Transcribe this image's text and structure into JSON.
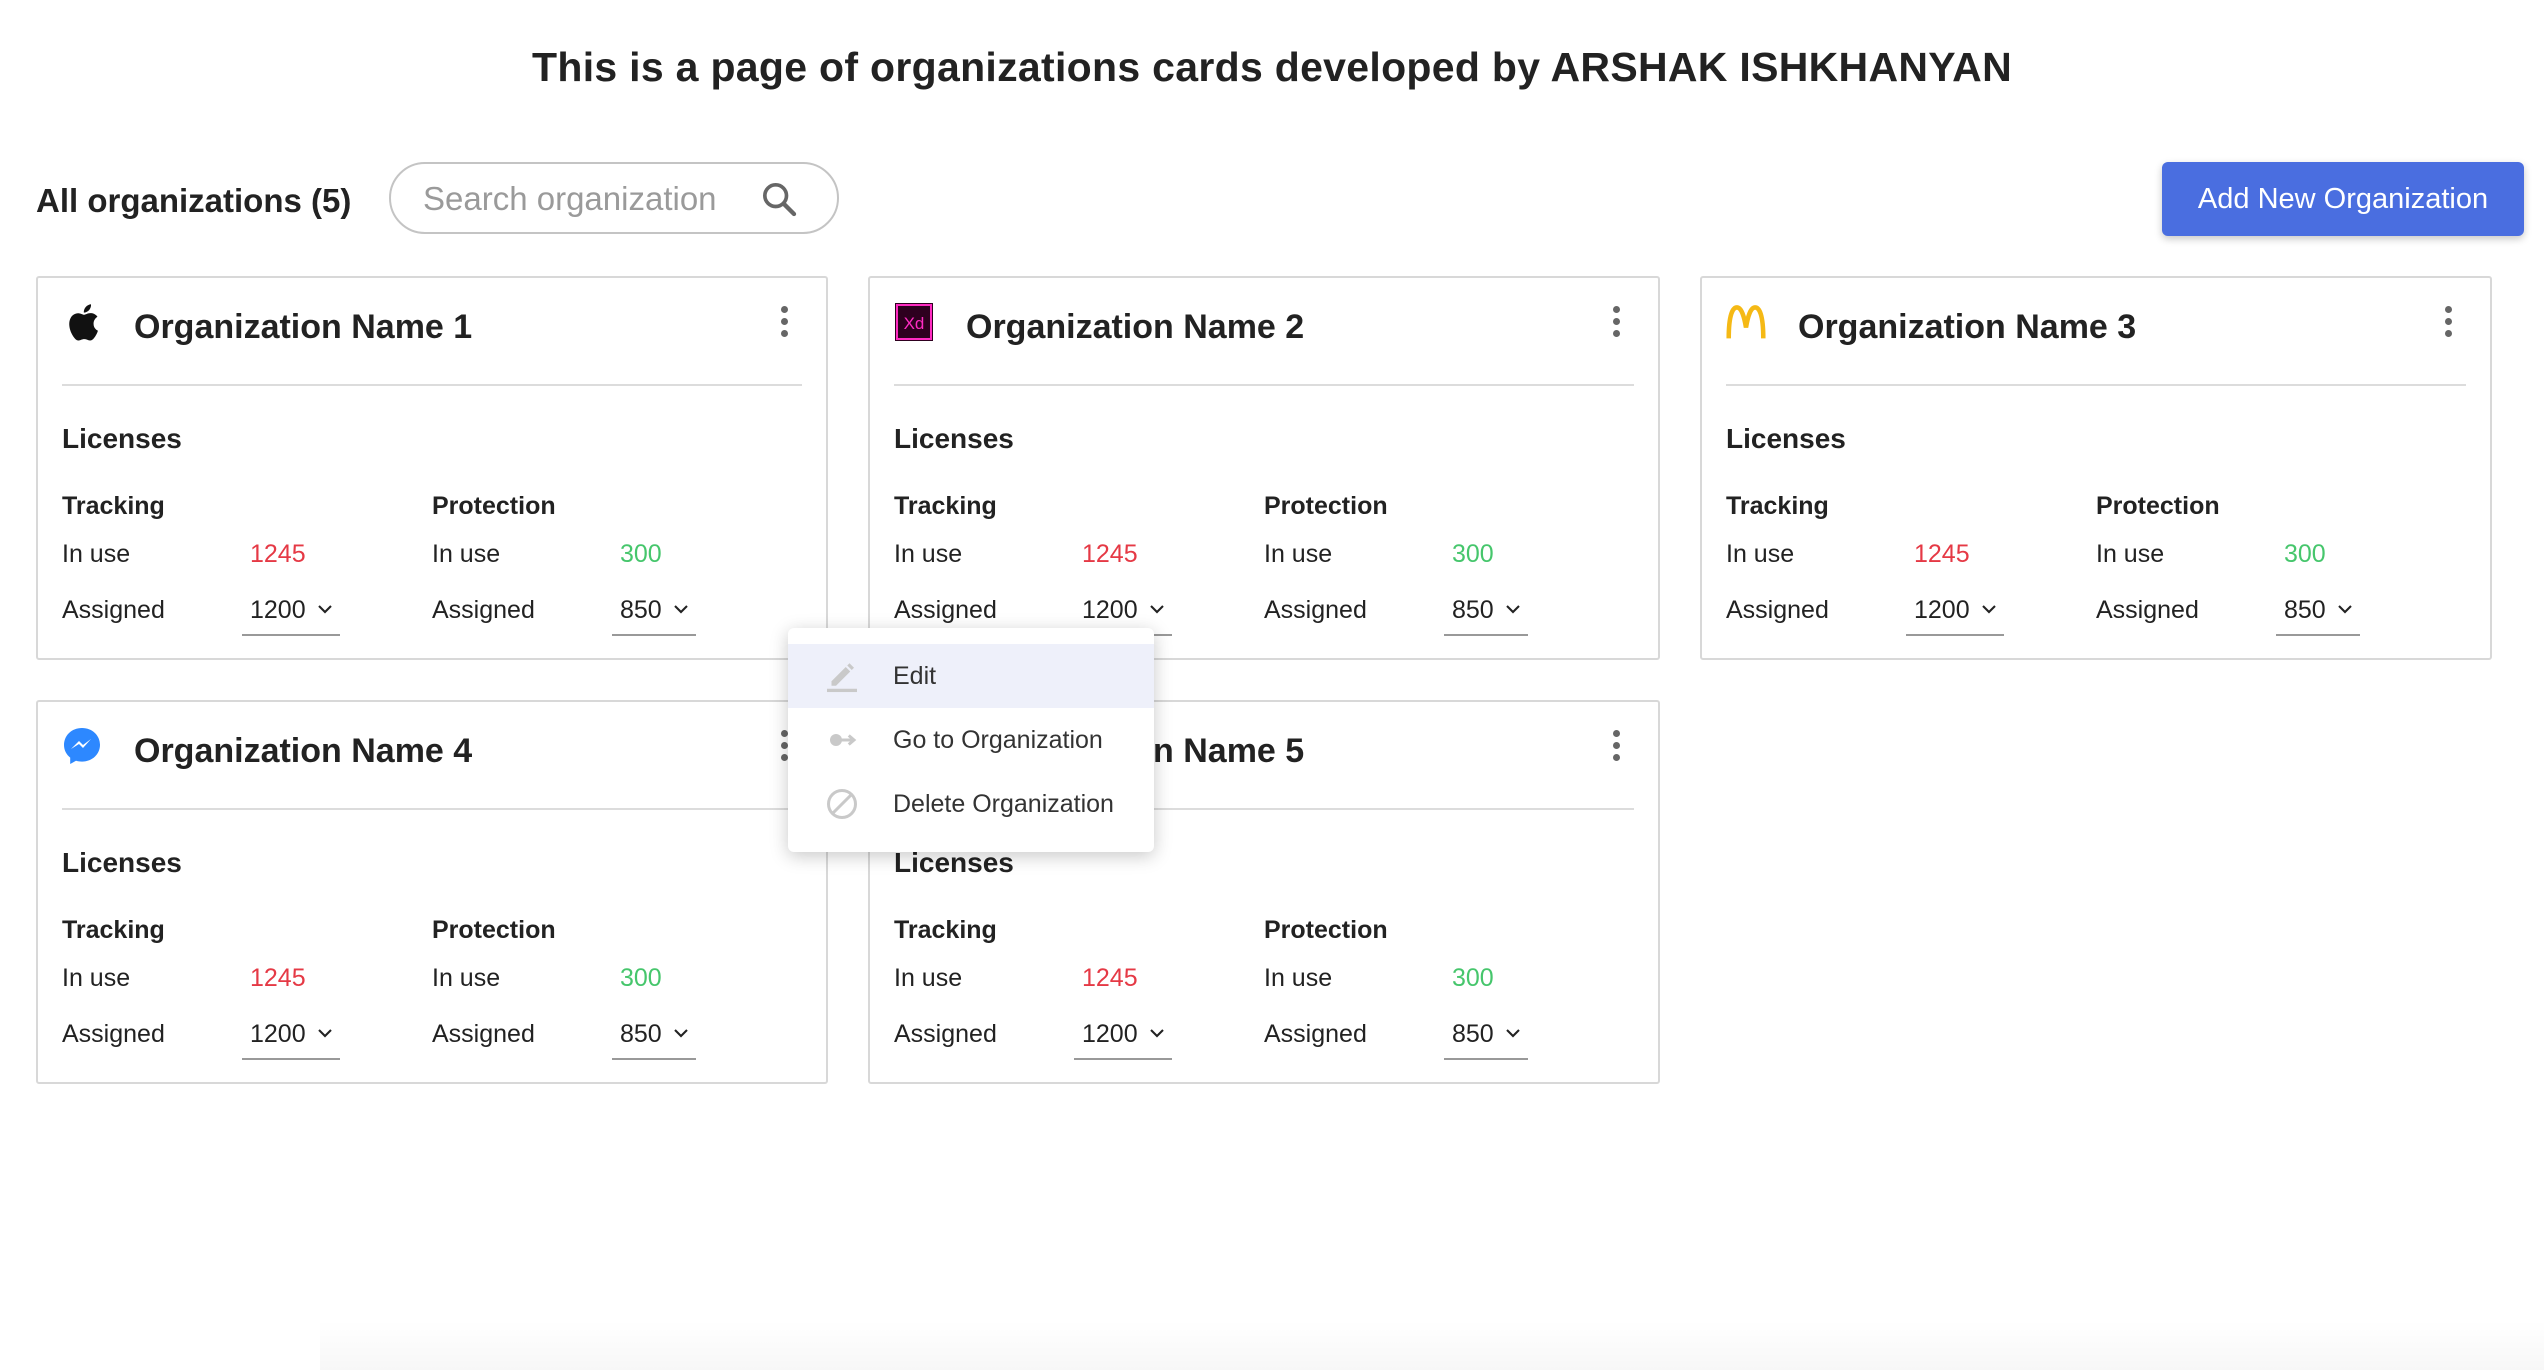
{
  "page": {
    "title": "This is a page of organizations cards developed by ARSHAK ISHKHANYAN"
  },
  "toolbar": {
    "all_label": "All organizations (5)",
    "search_placeholder": "Search organization",
    "add_button": "Add New Organization",
    "accent_color": "#4a6ee0"
  },
  "context_menu": {
    "items": [
      {
        "label": "Edit",
        "icon": "pencil-icon"
      },
      {
        "label": "Go to Organization",
        "icon": "arrow-right-icon"
      },
      {
        "label": "Delete Organization",
        "icon": "block-icon"
      }
    ]
  },
  "licenses_label": "Licenses",
  "organizations": [
    {
      "name": "Organization Name 1",
      "logo": "apple-logo-icon",
      "tracking": {
        "title": "Tracking",
        "in_use_label": "In use",
        "in_use": "1245",
        "assigned_label": "Assigned",
        "assigned": "1200"
      },
      "protection": {
        "title": "Protection",
        "in_use_label": "In use",
        "in_use": "300",
        "assigned_label": "Assigned",
        "assigned": "850"
      }
    },
    {
      "name": "Organization Name 2",
      "logo": "adobe-xd-logo-icon",
      "tracking": {
        "title": "Tracking",
        "in_use_label": "In use",
        "in_use": "1245",
        "assigned_label": "Assigned",
        "assigned": "1200"
      },
      "protection": {
        "title": "Protection",
        "in_use_label": "In use",
        "in_use": "300",
        "assigned_label": "Assigned",
        "assigned": "850"
      }
    },
    {
      "name": "Organization Name 3",
      "logo": "mcdonalds-logo-icon",
      "tracking": {
        "title": "Tracking",
        "in_use_label": "In use",
        "in_use": "1245",
        "assigned_label": "Assigned",
        "assigned": "1200"
      },
      "protection": {
        "title": "Protection",
        "in_use_label": "In use",
        "in_use": "300",
        "assigned_label": "Assigned",
        "assigned": "850"
      }
    },
    {
      "name": "Organization Name 4",
      "logo": "messenger-logo-icon",
      "tracking": {
        "title": "Tracking",
        "in_use_label": "In use",
        "in_use": "1245",
        "assigned_label": "Assigned",
        "assigned": "1200"
      },
      "protection": {
        "title": "Protection",
        "in_use_label": "In use",
        "in_use": "300",
        "assigned_label": "Assigned",
        "assigned": "850"
      }
    },
    {
      "name": "Organization Name 5",
      "logo": "google-logo-icon",
      "tracking": {
        "title": "Tracking",
        "in_use_label": "In use",
        "in_use": "1245",
        "assigned_label": "Assigned",
        "assigned": "1200"
      },
      "protection": {
        "title": "Protection",
        "in_use_label": "In use",
        "in_use": "300",
        "assigned_label": "Assigned",
        "assigned": "850"
      }
    }
  ],
  "colors": {
    "in_use_tracking": "#e53945",
    "in_use_protection": "#46c66c"
  }
}
